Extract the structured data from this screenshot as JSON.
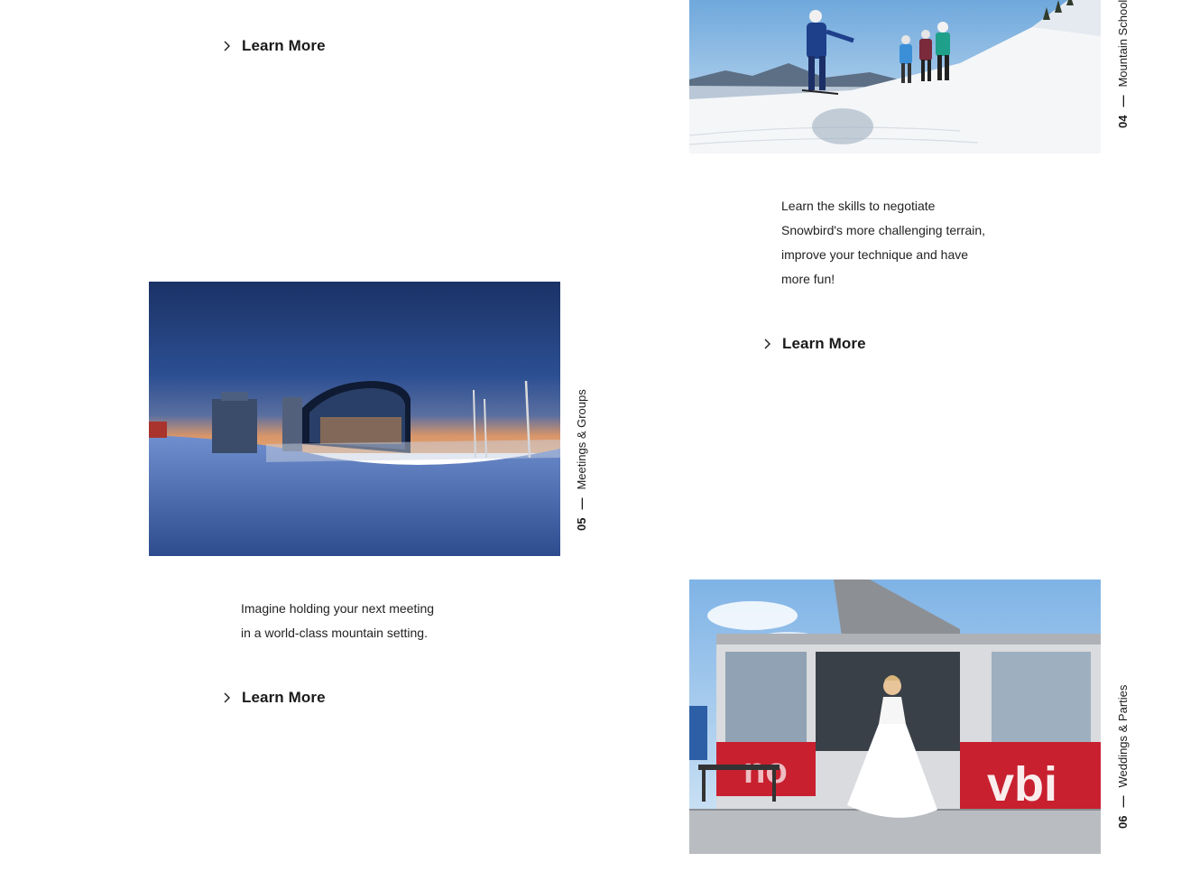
{
  "sections": {
    "ski_school": {
      "number": "04",
      "dash": "—",
      "title": "Mountain School",
      "description_lines": [
        "Learn the skills to negotiate",
        "Snowbird's more challenging terrain,",
        "improve your technique and have",
        "more fun!"
      ],
      "link_label": "Learn More"
    },
    "meetings": {
      "number": "05",
      "dash": "—",
      "title": "Meetings & Groups",
      "description_lines": [
        "Imagine holding your next meeting",
        "in a world-class mountain setting."
      ],
      "link_label": "Learn More"
    },
    "weddings": {
      "number": "06",
      "dash": "—",
      "title": "Weddings & Parties"
    },
    "previous": {
      "link_label": "Learn More"
    }
  },
  "icons": {
    "link": "chevron-right-icon"
  },
  "colors": {
    "text": "#1a1a1a",
    "tram_red": "#c8202f",
    "dusk_blue": "#1f3d78",
    "snow": "#f4f6f8"
  }
}
